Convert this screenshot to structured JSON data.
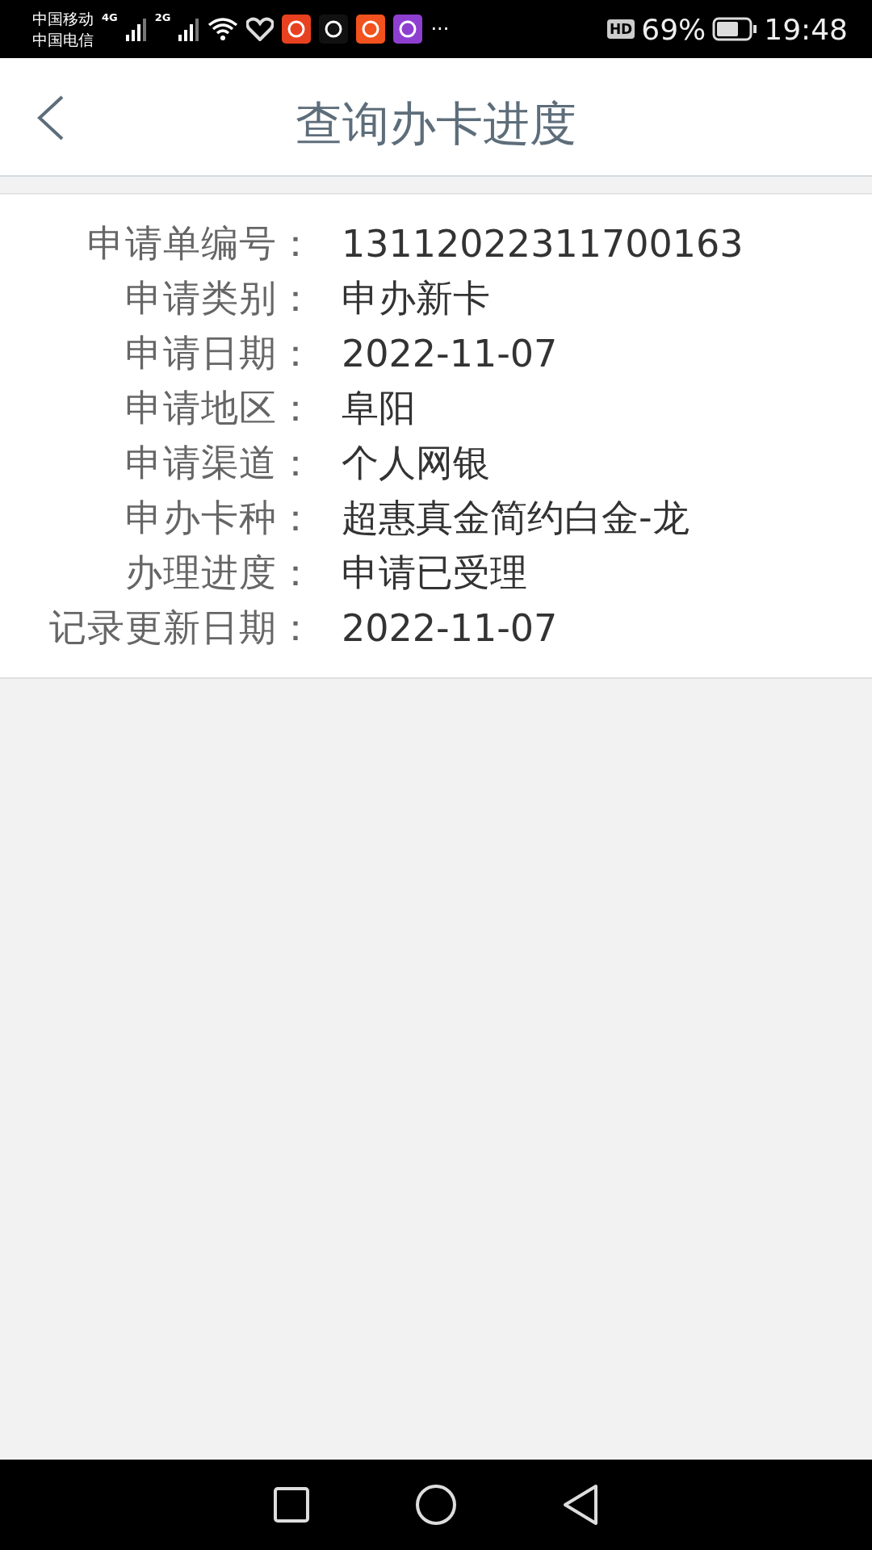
{
  "status_bar": {
    "carrier_1": "中国移动",
    "carrier_2": "中国电信",
    "net_1": "4G",
    "net_2": "2G",
    "more": "···",
    "hd": "HD",
    "battery": "69%",
    "time": "19:48"
  },
  "header": {
    "title": "查询办卡进度"
  },
  "details": [
    {
      "label": "申请单编号：",
      "value": "13112022311700163"
    },
    {
      "label": "申请类别：",
      "value": "申办新卡"
    },
    {
      "label": "申请日期：",
      "value": "2022-11-07"
    },
    {
      "label": "申请地区：",
      "value": "阜阳"
    },
    {
      "label": "申请渠道：",
      "value": "个人网银"
    },
    {
      "label": "申办卡种：",
      "value": "超惠真金简约白金-龙"
    },
    {
      "label": "办理进度：",
      "value": "申请已受理"
    },
    {
      "label": "记录更新日期：",
      "value": "2022-11-07"
    }
  ]
}
